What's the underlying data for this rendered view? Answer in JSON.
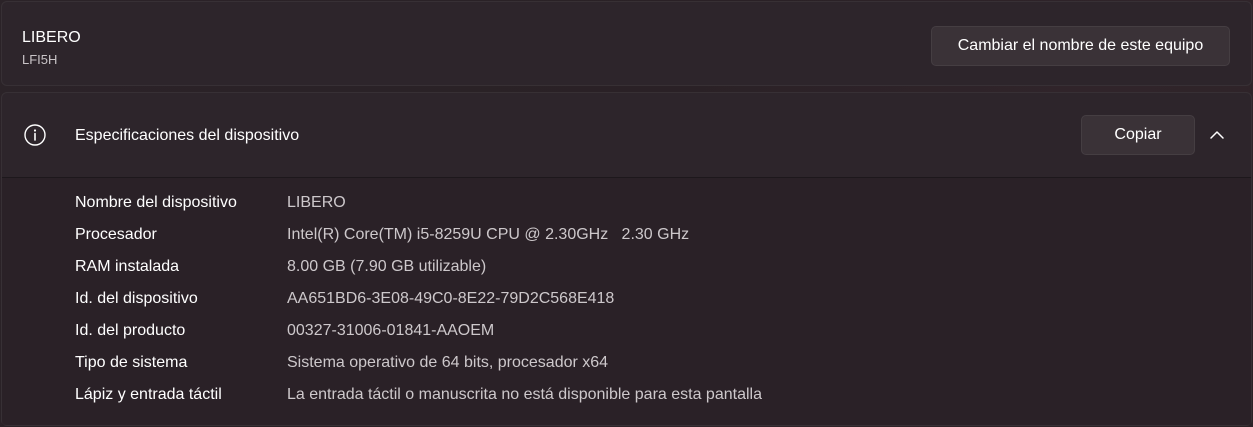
{
  "device": {
    "name": "LIBERO",
    "model": "LFI5H",
    "rename_button": "Cambiar el nombre de este equipo"
  },
  "specs": {
    "title": "Especificaciones del dispositivo",
    "copy_button": "Copiar",
    "rows": [
      {
        "label": "Nombre del dispositivo",
        "value": "LIBERO"
      },
      {
        "label": "Procesador",
        "value": "Intel(R) Core(TM) i5-8259U CPU @ 2.30GHz   2.30 GHz"
      },
      {
        "label": "RAM instalada",
        "value": "8.00 GB (7.90 GB utilizable)"
      },
      {
        "label": "Id. del dispositivo",
        "value": "AA651BD6-3E08-49C0-8E22-79D2C568E418"
      },
      {
        "label": "Id. del producto",
        "value": "00327-31006-01841-AAOEM"
      },
      {
        "label": "Tipo de sistema",
        "value": "Sistema operativo de 64 bits, procesador x64"
      },
      {
        "label": "Lápiz y entrada táctil",
        "value": "La entrada táctil o manuscrita no está disponible para esta pantalla"
      }
    ]
  },
  "icons": {
    "info": "info-icon",
    "collapse": "chevron-up-icon"
  }
}
